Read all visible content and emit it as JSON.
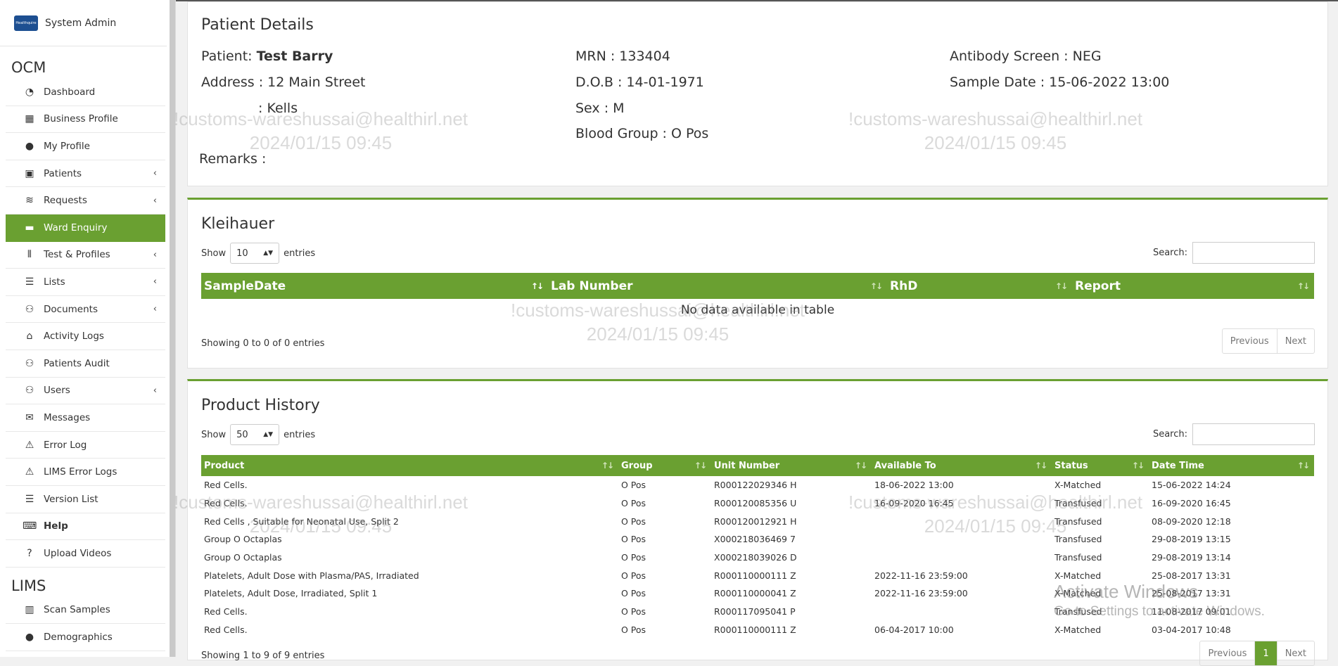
{
  "sidebar": {
    "brand": "System Admin",
    "logo_text": "Healthquire",
    "section_ocm": "OCM",
    "section_lims": "LIMS",
    "items": [
      {
        "label": "Dashboard",
        "icon": "dashboard-icon",
        "glyph": "◔",
        "chevron": false
      },
      {
        "label": "Business Profile",
        "icon": "building-icon",
        "glyph": "▦",
        "chevron": false
      },
      {
        "label": "My Profile",
        "icon": "user-icon",
        "glyph": "●",
        "chevron": false
      },
      {
        "label": "Patients",
        "icon": "id-card-icon",
        "glyph": "▣",
        "chevron": true
      },
      {
        "label": "Requests",
        "icon": "database-icon",
        "glyph": "≋",
        "chevron": true
      },
      {
        "label": "Ward Enquiry",
        "icon": "bed-icon",
        "glyph": "▬",
        "chevron": false,
        "active": true
      },
      {
        "label": "Test & Profiles",
        "icon": "vials-icon",
        "glyph": "⫴",
        "chevron": true
      },
      {
        "label": "Lists",
        "icon": "list-icon",
        "glyph": "☰",
        "chevron": true
      },
      {
        "label": "Documents",
        "icon": "users-icon",
        "glyph": "⚇",
        "chevron": true
      },
      {
        "label": "Activity Logs",
        "icon": "warehouse-icon",
        "glyph": "⌂",
        "chevron": false
      },
      {
        "label": "Patients Audit",
        "icon": "users-icon",
        "glyph": "⚇",
        "chevron": false
      },
      {
        "label": "Users",
        "icon": "users-icon",
        "glyph": "⚇",
        "chevron": true
      },
      {
        "label": "Messages",
        "icon": "envelope-icon",
        "glyph": "✉",
        "chevron": false
      },
      {
        "label": "Error Log",
        "icon": "warning-icon",
        "glyph": "⚠",
        "chevron": false
      },
      {
        "label": "LIMS Error Logs",
        "icon": "warning-icon",
        "glyph": "⚠",
        "chevron": false
      },
      {
        "label": "Version List",
        "icon": "list-icon",
        "glyph": "☰",
        "chevron": false
      },
      {
        "label": "Help",
        "icon": "keyboard-icon",
        "glyph": "⌨",
        "chevron": false,
        "bold": true
      },
      {
        "label": "Upload Videos",
        "icon": "question-icon",
        "glyph": "?",
        "chevron": false
      }
    ],
    "lims_items": [
      {
        "label": "Scan Samples",
        "icon": "barcode-icon",
        "glyph": "▥"
      },
      {
        "label": "Demographics",
        "icon": "user-edit-icon",
        "glyph": "●"
      }
    ]
  },
  "patient_details": {
    "title": "Patient Details",
    "patient_label": "Patient:",
    "patient_name": "Test Barry",
    "address": "Address : 12 Main Street",
    "address2": ": Kells",
    "remarks": "Remarks :",
    "mrn": "MRN : 133404",
    "dob": "D.O.B : 14-01-1971",
    "sex": "Sex : M",
    "blood_group": "Blood Group : O Pos",
    "antibody_screen": "Antibody Screen : NEG",
    "sample_date": "Sample Date : 15-06-2022 13:00"
  },
  "kleihauer": {
    "title": "Kleihauer",
    "show": "Show",
    "entries_value": "10",
    "entries": "entries",
    "search_label": "Search:",
    "columns": [
      "SampleDate",
      "Lab Number",
      "RhD",
      "Report"
    ],
    "empty_text": "No data available in table",
    "info": "Showing 0 to 0 of 0 entries",
    "prev": "Previous",
    "next": "Next"
  },
  "product_history": {
    "title": "Product History",
    "show": "Show",
    "entries_value": "50",
    "entries": "entries",
    "search_label": "Search:",
    "columns": [
      "Product",
      "Group",
      "Unit Number",
      "Available To",
      "Status",
      "Date Time"
    ],
    "rows": [
      [
        "Red Cells.",
        "O Pos",
        "R000122029346 H",
        "18-06-2022 13:00",
        "X-Matched",
        "15-06-2022 14:24"
      ],
      [
        "Red Cells.",
        "O Pos",
        "R000120085356 U",
        "16-09-2020 16:45",
        "Transfused",
        "16-09-2020 16:45"
      ],
      [
        "Red Cells , Suitable for Neonatal Use, Split 2",
        "O Pos",
        "R000120012921 H",
        "",
        "Transfused",
        "08-09-2020 12:18"
      ],
      [
        "Group O Octaplas",
        "O Pos",
        "X000218036469 7",
        "",
        "Transfused",
        "29-08-2019 13:15"
      ],
      [
        "Group O Octaplas",
        "O Pos",
        "X000218039026 D",
        "",
        "Transfused",
        "29-08-2019 13:14"
      ],
      [
        "Platelets, Adult Dose with Plasma/PAS, Irradiated",
        "O Pos",
        "R000110000111 Z",
        "2022-11-16 23:59:00",
        "X-Matched",
        "25-08-2017 13:31"
      ],
      [
        "Platelets, Adult Dose, Irradiated, Split 1",
        "O Pos",
        "R000110000041 Z",
        "2022-11-16 23:59:00",
        "X-Matched",
        "25-08-2017 13:31"
      ],
      [
        "Red Cells.",
        "O Pos",
        "R000117095041 P",
        "",
        "Transfused",
        "11-08-2017 09:01"
      ],
      [
        "Red Cells.",
        "O Pos",
        "R000110000111 Z",
        "06-04-2017 10:00",
        "X-Matched",
        "03-04-2017 10:48"
      ]
    ],
    "info": "Showing 1 to 9 of 9 entries",
    "prev": "Previous",
    "page": "1",
    "next": "Next"
  },
  "watermark": {
    "line1": "!customs-wareshussai@healthirl.net",
    "line2": "2024/01/15 09:45"
  },
  "os_overlay": {
    "line1": "Activate Windows",
    "line2": "Go to Settings to activate Windows."
  },
  "colors": {
    "accent": "#6aa031"
  }
}
